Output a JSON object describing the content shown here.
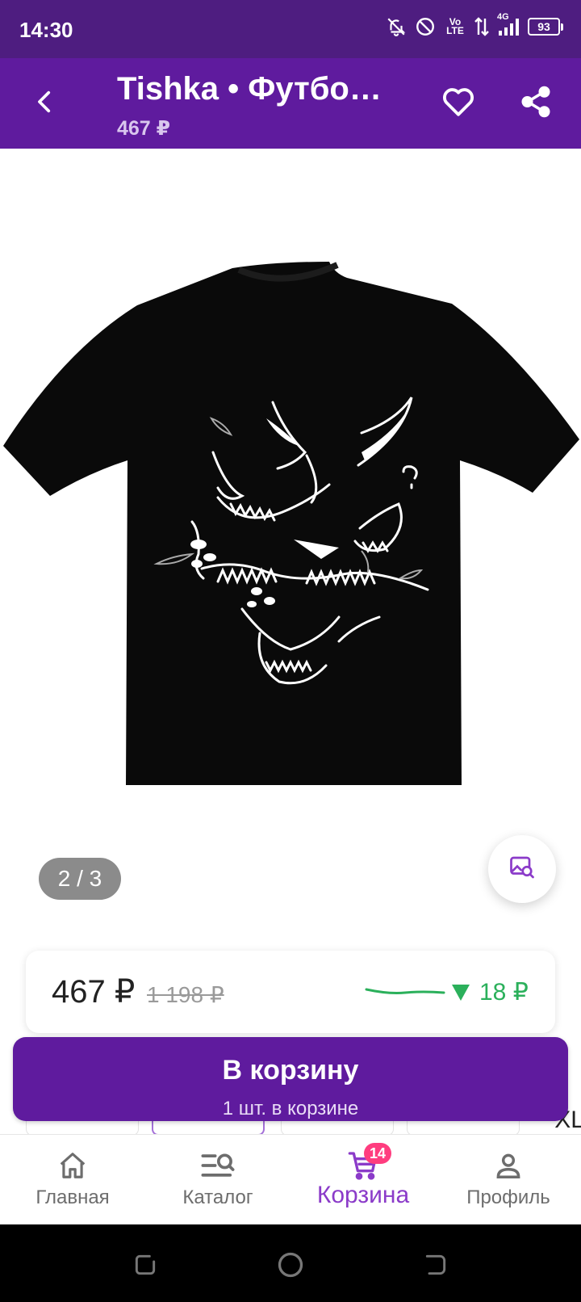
{
  "status_bar": {
    "time": "14:30",
    "network_label": "Vo LTE",
    "network_type": "4G",
    "battery": "93",
    "icons": [
      "bell-off-icon",
      "do-not-disturb-icon",
      "volte-icon",
      "data-transfer-icon",
      "signal-icon",
      "battery-icon"
    ]
  },
  "header": {
    "title": "Tishka • Футбо…",
    "price": "467 ₽",
    "icons": [
      "back-arrow-icon",
      "heart-icon",
      "share-icon"
    ]
  },
  "gallery": {
    "page_indicator": "2 / 3",
    "visual_search_icon": "image-search-icon"
  },
  "price_card": {
    "current_price": "467 ₽",
    "old_price": "1 198 ₽",
    "price_drop": "18 ₽",
    "trend_color": "#2bb05b"
  },
  "size_strip": {
    "overflow_label": "XL"
  },
  "cart_button": {
    "label": "В корзину",
    "sub_label": "1 шт. в корзине"
  },
  "bottom_nav": {
    "items": [
      {
        "label": "Главная",
        "icon": "home-icon"
      },
      {
        "label": "Каталог",
        "icon": "catalog-search-icon"
      },
      {
        "label": "Корзина",
        "icon": "cart-icon",
        "badge": "14",
        "active": true
      },
      {
        "label": "Профиль",
        "icon": "profile-icon"
      }
    ]
  },
  "colors": {
    "brand": "#5f1b9e",
    "status_bar": "#4e1d80",
    "active_nav": "#8b3bc9",
    "badge": "#ff3d7f",
    "price_drop": "#2bb05b"
  }
}
